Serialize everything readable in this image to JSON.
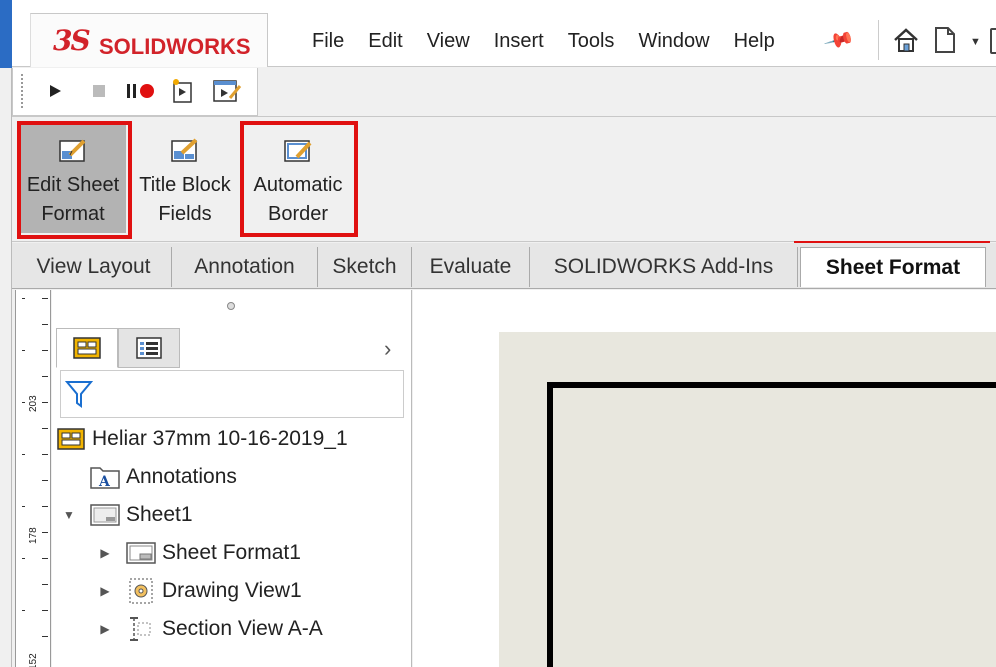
{
  "app": {
    "brand_ds": "3S",
    "brand_name": "SOLIDWORKS"
  },
  "menu": {
    "items": [
      "File",
      "Edit",
      "View",
      "Insert",
      "Tools",
      "Window",
      "Help"
    ]
  },
  "toolbar_icons": [
    "pin-icon",
    "home-icon",
    "new-document-icon",
    "dropdown-caret-icon",
    "open-icon"
  ],
  "macro_toolbar": {
    "icons": [
      "play-icon",
      "stop-icon",
      "pause-record-icon",
      "new-macro-icon",
      "edit-macro-icon"
    ]
  },
  "ribbon": {
    "buttons": [
      {
        "label_line1": "Edit Sheet",
        "label_line2": "Format",
        "active": true,
        "highlighted": true
      },
      {
        "label_line1": "Title Block",
        "label_line2": "Fields",
        "active": false,
        "highlighted": false
      },
      {
        "label_line1": "Automatic",
        "label_line2": "Border",
        "active": false,
        "highlighted": true
      }
    ]
  },
  "tabs": {
    "items": [
      "View Layout",
      "Annotation",
      "Sketch",
      "Evaluate",
      "SOLIDWORKS Add-Ins",
      "Sheet Format"
    ],
    "active": "Sheet Format"
  },
  "ruler": {
    "labels": [
      "203",
      "178",
      "152"
    ]
  },
  "feature_manager": {
    "tree": [
      {
        "label": "Heliar 37mm 10-16-2019_1",
        "icon": "drawing-icon",
        "level": 0,
        "expander": ""
      },
      {
        "label": "Annotations",
        "icon": "annotations-folder-icon",
        "level": 1,
        "expander": ""
      },
      {
        "label": "Sheet1",
        "icon": "sheet-icon",
        "level": 1,
        "expander": "▼"
      },
      {
        "label": "Sheet Format1",
        "icon": "sheet-format-icon",
        "level": 2,
        "expander": "▶"
      },
      {
        "label": "Drawing View1",
        "icon": "drawing-view-icon",
        "level": 2,
        "expander": "▶"
      },
      {
        "label": "Section View A-A",
        "icon": "section-view-icon",
        "level": 2,
        "expander": "▶"
      }
    ]
  },
  "colors": {
    "brand_red": "#d2232a",
    "highlight_red": "#e01010",
    "window_blue": "#2b6cc4",
    "sheet_bg": "#e8e7de"
  }
}
